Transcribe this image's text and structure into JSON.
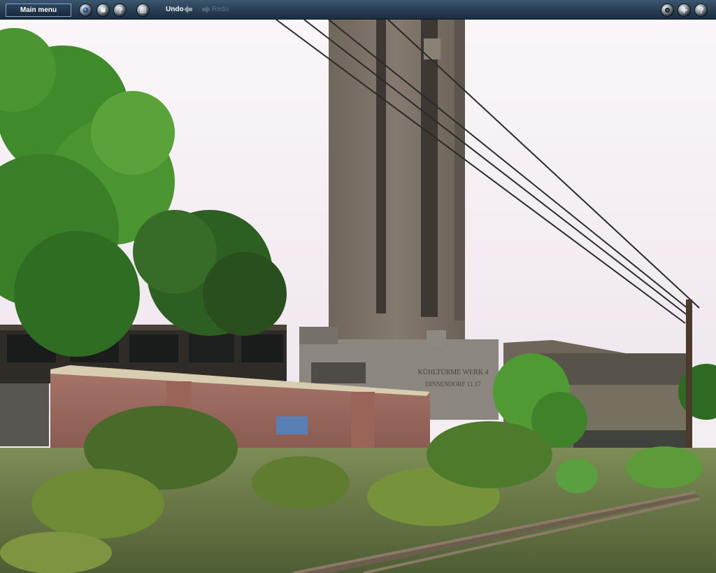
{
  "toolbar": {
    "main_menu_label": "Main menu",
    "undo_label": "Undo",
    "redo_label": "Redo",
    "left_icons": [
      "earth-icon",
      "stop-icon",
      "help-icon",
      "grid-icon"
    ],
    "right_icons": [
      "camera-icon",
      "plus-icon",
      "help-icon"
    ],
    "bar_color": "#2b4258",
    "accent_color": "#8aa6c2"
  },
  "scene": {
    "building_sign_line1": "KÜHLTÜRME WERK 4",
    "building_sign_line2": "DINSENDORF 11.17"
  }
}
